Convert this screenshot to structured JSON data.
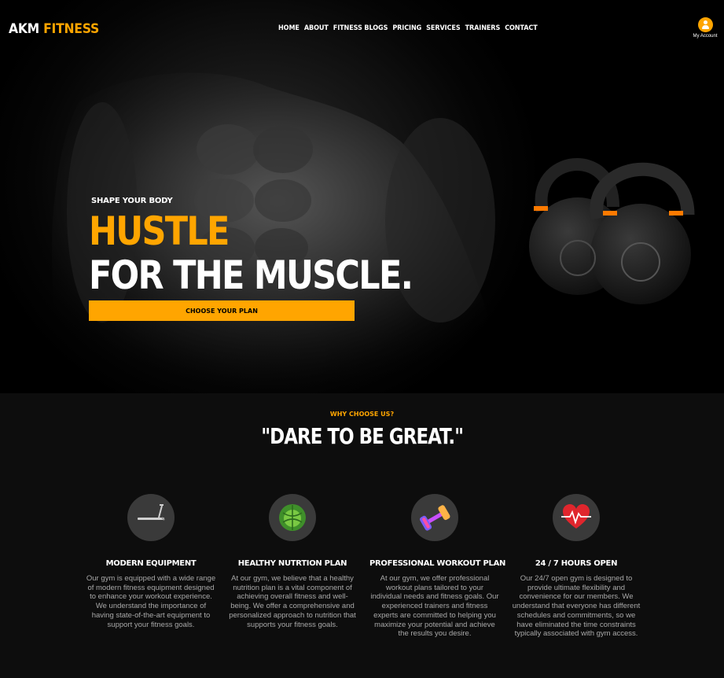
{
  "brand": {
    "logo_part1": "AKM",
    "logo_part2": "FITNESS",
    "accent": "#ffa500"
  },
  "nav": [
    "HOME",
    "ABOUT",
    "FITNESS BLOGS",
    "PRICING",
    "SERVICES",
    "TRAINERS",
    "CONTACT"
  ],
  "account": {
    "label": "My Account",
    "icon": "user-icon"
  },
  "hero": {
    "eyebrow": "SHAPE YOUR BODY",
    "headline_1": "HUSTLE",
    "headline_2": "FOR THE MUSCLE.",
    "cta": "CHOOSE YOUR PLAN"
  },
  "why": {
    "eyebrow": "WHY CHOOSE US?",
    "title": "\"DARE TO BE GREAT.\"",
    "features": [
      {
        "icon": "treadmill-icon",
        "title": "MODERN EQUIPMENT",
        "text": "Our gym is equipped with a wide range of modern fitness equipment designed to enhance your workout experience. We understand the importance of having state-of-the-art equipment to support your fitness goals."
      },
      {
        "icon": "cabbage-icon",
        "title": "HEALTHY NUTRTION PLAN",
        "text": "At our gym, we believe that a healthy nutrition plan is a vital component of achieving overall fitness and well-being. We offer a comprehensive and personalized approach to nutrition that supports your fitness goals."
      },
      {
        "icon": "dumbbell-icon",
        "title": "PROFESSIONAL WORKOUT PLAN",
        "text": "At our gym, we offer professional workout plans tailored to your individual needs and fitness goals. Our experienced trainers and fitness experts are committed to helping you maximize your potential and achieve the results you desire."
      },
      {
        "icon": "heartbeat-icon",
        "title": "24 / 7 HOURS OPEN",
        "text": "Our 24/7 open gym is designed to provide ultimate flexibility and convenience for our members. We understand that everyone has different schedules and commitments, so we have eliminated the time constraints typically associated with gym access."
      }
    ]
  }
}
